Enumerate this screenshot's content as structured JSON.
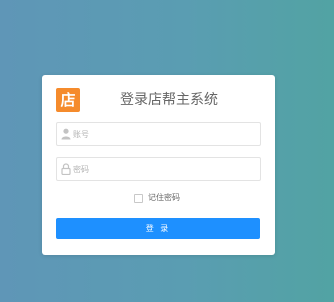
{
  "login": {
    "logo_char": "店",
    "title": "登录店帮主系统",
    "username_placeholder": "账号",
    "password_placeholder": "密码",
    "remember_label": "记住密码",
    "remember_checked": false,
    "submit_label": "登 录"
  },
  "colors": {
    "logo_bg": "#f58b2c",
    "button_bg": "#1e90ff"
  },
  "icons": {
    "username": "user-icon",
    "password": "lock-icon"
  }
}
